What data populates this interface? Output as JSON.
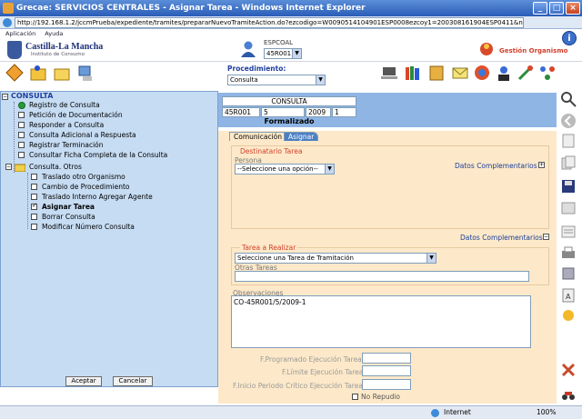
{
  "window": {
    "title": "Grecae: SERVICIOS CENTRALES - Asignar Tarea - Windows Internet Explorer",
    "url": "http://192.168.1.2/jccmPrueba/expediente/tramites/prepararNuevoTramiteAction.do?ezcodigo=W0090514104901ESP0008ezcoy1=200308161904ESP0411&nodo=200611171715ESP50249#"
  },
  "menu": [
    "Aplicación",
    "Ayuda"
  ],
  "header": {
    "logo_title": "Castilla-La Mancha",
    "logo_subtitle": "Instituto de Consumo",
    "esp_label": "ESPCOAL",
    "esp_value": "45R001",
    "gestion_label": "Gestión Organismo",
    "procedimiento_label": "Procedimiento:",
    "procedimiento_value": "Consulta"
  },
  "tree": {
    "root": "CONSULTA",
    "items": [
      {
        "label": "Registro de Consulta",
        "state": "current"
      },
      {
        "label": "Petición de Documentación",
        "state": "unchecked"
      },
      {
        "label": "Responder a Consulta",
        "state": "unchecked"
      },
      {
        "label": "Consulta Adicional a Respuesta",
        "state": "unchecked"
      },
      {
        "label": "Registrar Terminación",
        "state": "unchecked"
      },
      {
        "label": "Consultar Ficha Completa de la Consulta",
        "state": "unchecked"
      }
    ],
    "folder": "Consulta. Otros",
    "sub_items": [
      {
        "label": "Traslado otro Organismo",
        "state": "unchecked"
      },
      {
        "label": "Cambio de Procedimiento",
        "state": "unchecked"
      },
      {
        "label": "Traslado Interno Agregar Agente",
        "state": "unchecked"
      },
      {
        "label": "Asignar Tarea",
        "state": "checked"
      },
      {
        "label": "Borrar Consulta",
        "state": "unchecked"
      },
      {
        "label": "Modificar Número Consulta",
        "state": "unchecked"
      }
    ],
    "accept_label": "Aceptar",
    "cancel_label": "Cancelar"
  },
  "record": {
    "header": "CONSULTA",
    "cells": [
      "45R001",
      "5",
      "2009",
      "1"
    ],
    "status": "Formalizado"
  },
  "tabs": [
    "Comunicación",
    "Asignar"
  ],
  "form": {
    "destinatario_title": "Destinatario Tarea",
    "persona_label": "Persona",
    "persona_value": "--Seleccione una opción--",
    "datos_complementarios_1": "Datos Complementarios",
    "datos_complementarios_2": "Datos Complementarios",
    "tarea_title": "Tarea a Realizar",
    "tarea_value": "Seleccione una Tarea de Tramitación",
    "otras_tareas_label": "Otras Tareas",
    "observaciones_label": "Observaciones",
    "observaciones_value": "CO-45R001/5/2009-1",
    "f_programado_label": "F.Programado Ejecución Tarea",
    "f_limite_label": "F.Límite Ejecución Tarea",
    "f_inicio_label": "F.Inicio Periodo Crítico Ejecución Tarea",
    "no_repudio_label": "No Repudio"
  },
  "statusbar": {
    "zone": "Internet",
    "zoom": "100%"
  }
}
